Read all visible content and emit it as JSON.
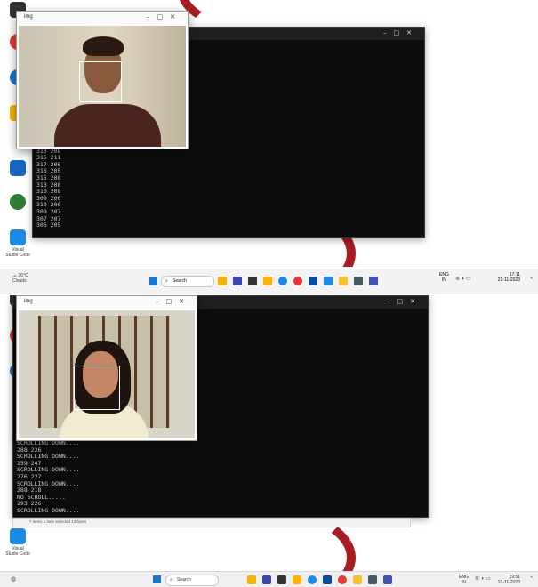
{
  "top": {
    "cam_title": "img",
    "console_lines": [
      "307 205",
      "313 208",
      "315 211",
      "317 206",
      "316 205",
      "315 208",
      "313 208",
      "310 208",
      "309 206",
      "310 206",
      "309 207",
      "307 207",
      "305 205"
    ],
    "desktop_label": "Visual Studio Code"
  },
  "gap_taskbar": {
    "weather_temp": "26°C",
    "weather_text": "Clouds",
    "search_placeholder": "Search",
    "lang_top": "ENG",
    "lang_bottom": "IN",
    "time": "17:11",
    "date": "21-11-2023"
  },
  "bottom": {
    "cam_title": "img",
    "console_lines": [
      "SCROLLING DOWN....",
      "288 226",
      "SCROLLING DOWN....",
      "259 247",
      "SCROLLING DOWN....",
      "276 227",
      "SCROLLING DOWN....",
      "288 218",
      "NO SCROLL.....",
      "293 226",
      "SCROLLING DOWN...."
    ],
    "explorer_status": "7 items    1 item selected  13 bytes",
    "desktop_label": "Visual Studio Code"
  },
  "bottom_taskbar": {
    "search_placeholder": "Search",
    "lang_top": "ENG",
    "lang_bottom": "IN",
    "time": "19:51",
    "date": "21-11-2023"
  },
  "colors": {
    "console_bg": "#0c0c0c",
    "accent_red": "#a81c22",
    "vscode_blue": "#1e88e5"
  }
}
